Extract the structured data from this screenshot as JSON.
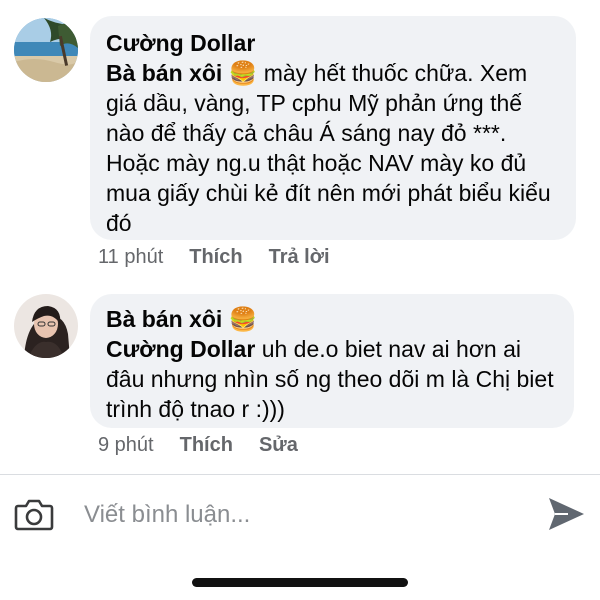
{
  "comments": [
    {
      "author": "Cường Dollar",
      "reply_to": "Bà bán xôi 🍔",
      "text": " mày hết thuốc chữa. Xem giá dầu, vàng, TP cphu Mỹ phản ứng thế nào để thấy cả châu Á sáng nay đỏ ***. Hoặc mày ng.u thật hoặc NAV mày ko đủ mua giấy chùi kẻ đít nên mới phát biểu kiểu đó",
      "time": "11 phút",
      "action_like": "Thích",
      "action_secondary": "Trả lời"
    },
    {
      "author": "Bà bán xôi 🍔",
      "reply_to": "Cường Dollar",
      "text": "uh de.o biet nav ai hơn ai đâu nhưng nhìn số ng theo dõi m là Chị biet trình độ tnao r :)))",
      "time": "9 phút",
      "action_like": "Thích",
      "action_secondary": "Sửa"
    }
  ],
  "composer": {
    "placeholder": "Viết bình luận..."
  },
  "colors": {
    "bubble": "#f0f2f5",
    "meta": "#65676b",
    "placeholder": "#8a8d91",
    "icon": "#606770"
  }
}
